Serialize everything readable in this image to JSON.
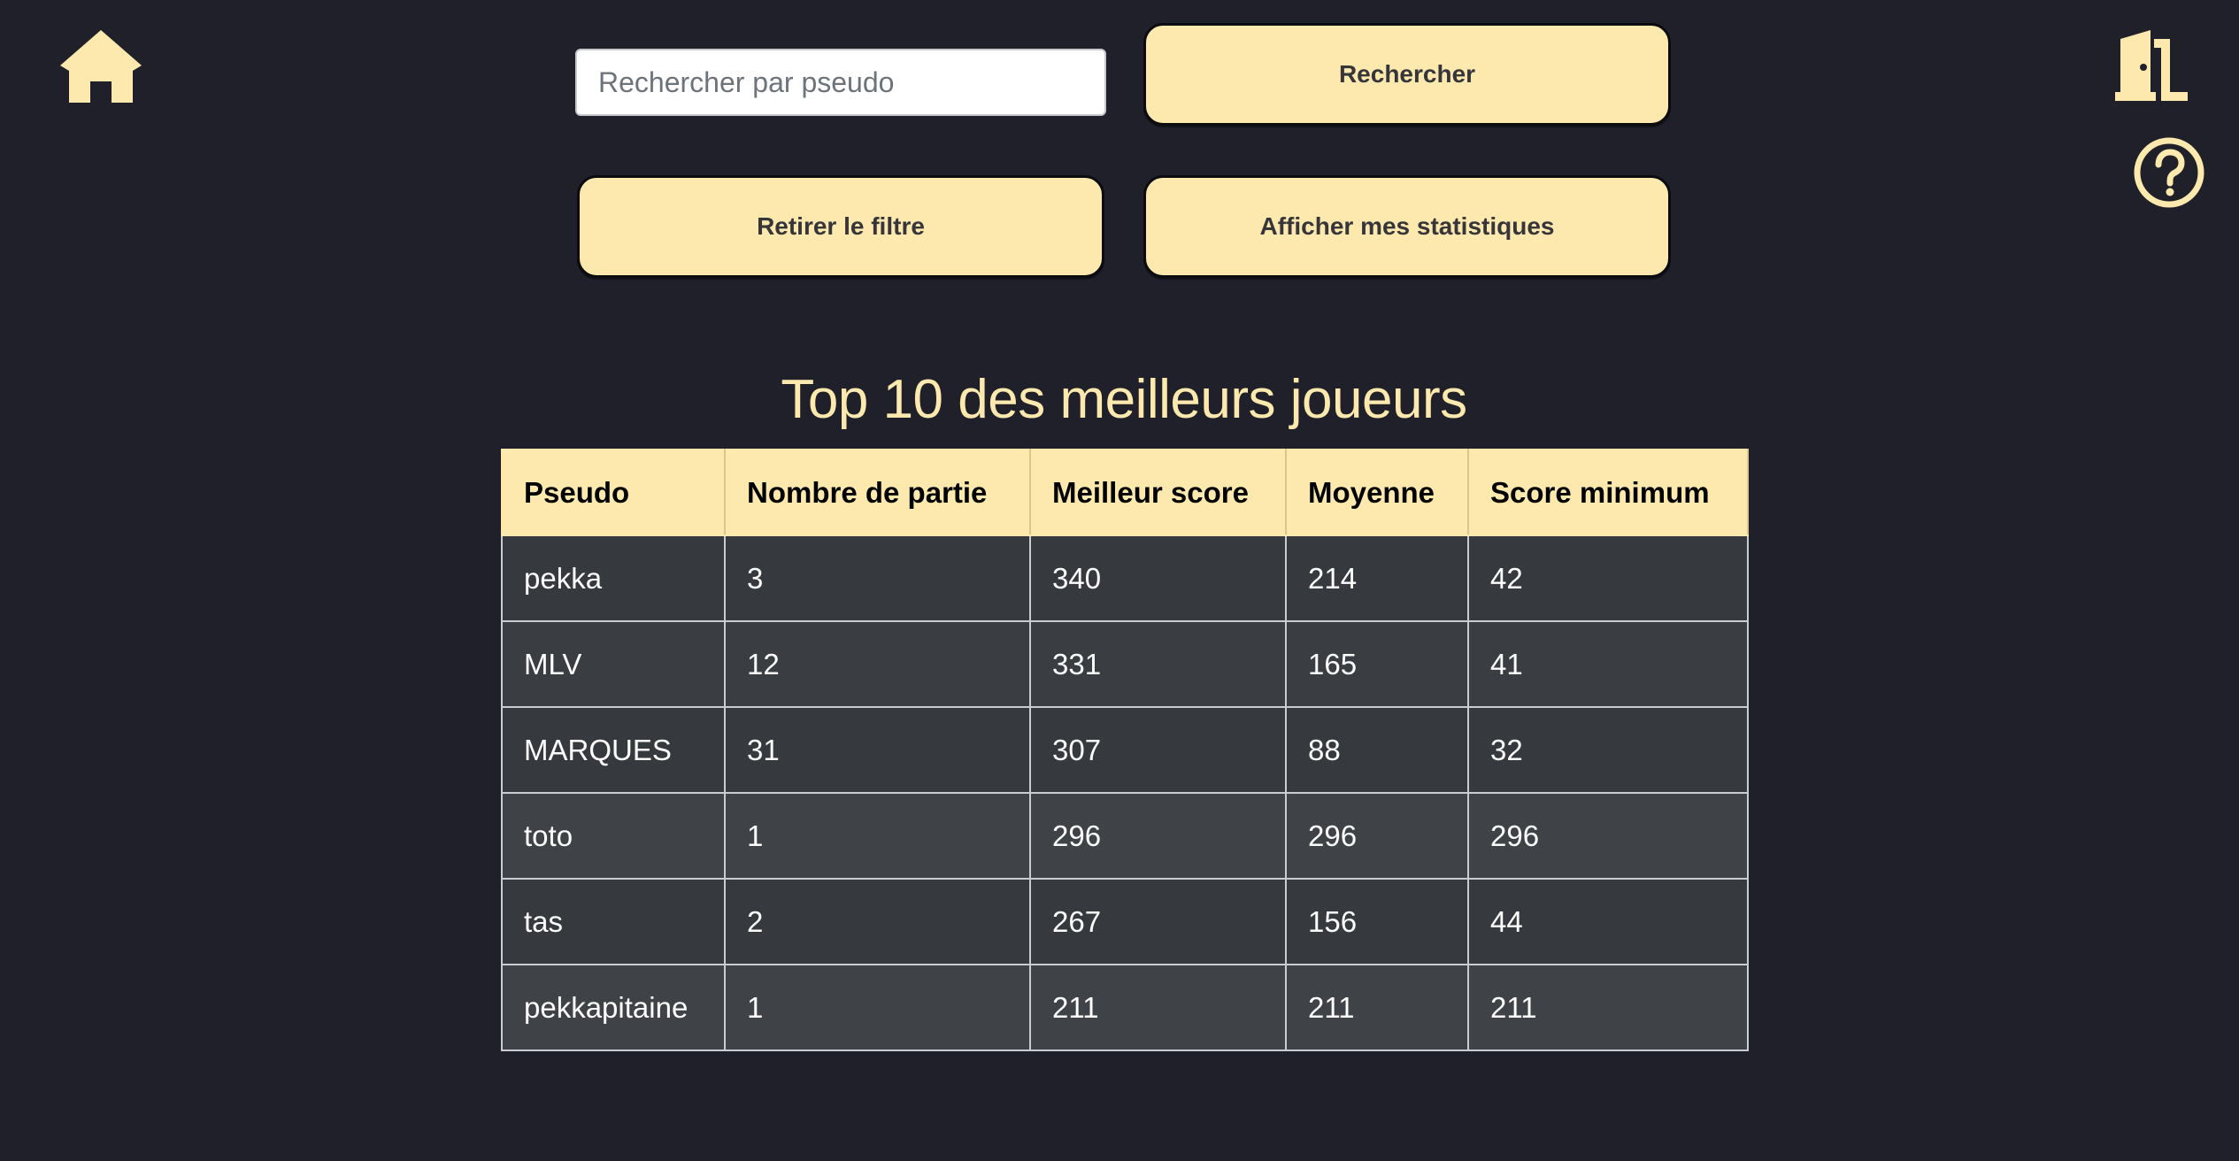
{
  "colors": {
    "background": "#1f2029",
    "accent": "#fde9ad",
    "table_row": "#363a3f",
    "table_text": "#ffffff"
  },
  "icons": {
    "home": "home-icon",
    "logout": "door-exit-icon",
    "help": "question-circle-icon"
  },
  "search": {
    "placeholder": "Rechercher par pseudo",
    "value": ""
  },
  "buttons": {
    "search_label": "Rechercher",
    "clear_filter_label": "Retirer le filtre",
    "my_stats_label": "Afficher mes statistiques"
  },
  "leaderboard": {
    "title": "Top 10 des meilleurs joueurs",
    "columns": [
      "Pseudo",
      "Nombre de partie",
      "Meilleur score",
      "Moyenne",
      "Score minimum"
    ],
    "rows": [
      [
        "pekka",
        "3",
        "340",
        "214",
        "42"
      ],
      [
        "MLV",
        "12",
        "331",
        "165",
        "41"
      ],
      [
        "MARQUES",
        "31",
        "307",
        "88",
        "32"
      ],
      [
        "toto",
        "1",
        "296",
        "296",
        "296"
      ],
      [
        "tas",
        "2",
        "267",
        "156",
        "44"
      ],
      [
        "pekkapitaine",
        "1",
        "211",
        "211",
        "211"
      ]
    ]
  }
}
